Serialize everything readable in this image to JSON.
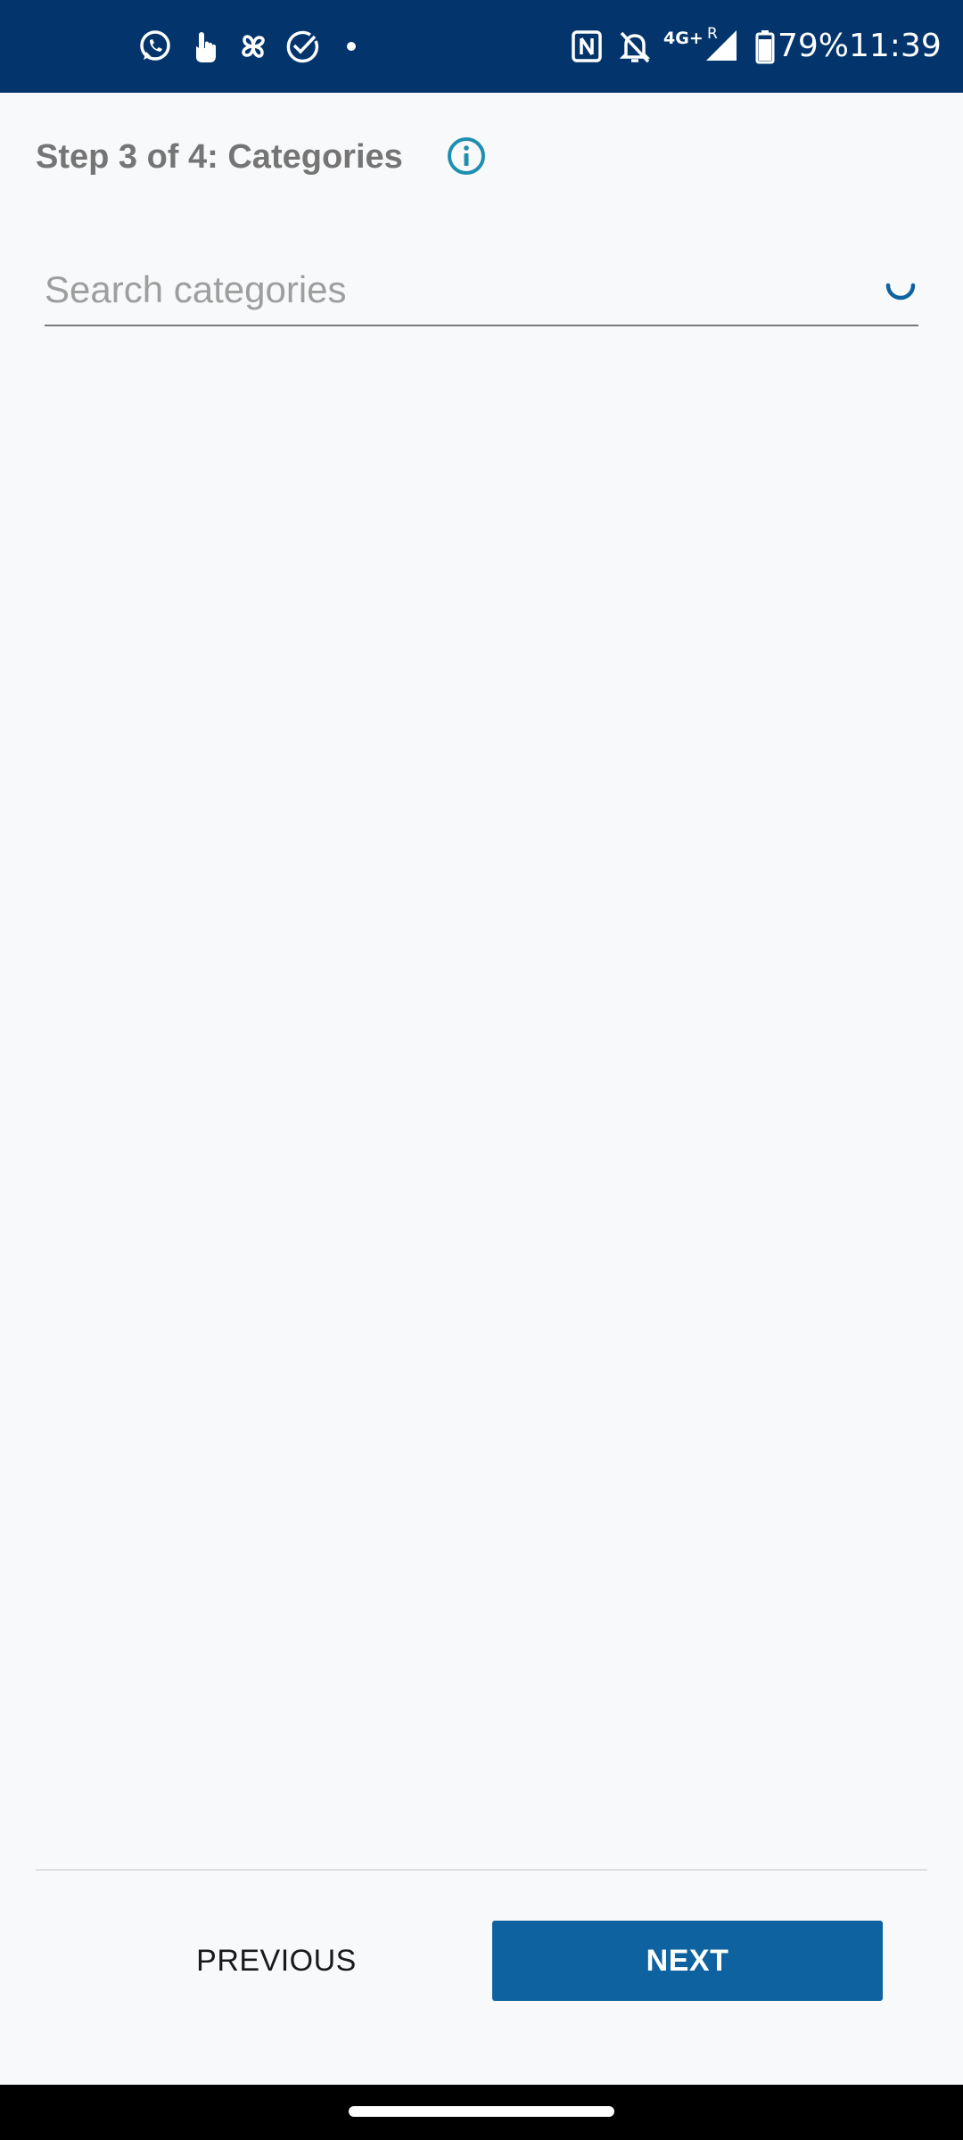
{
  "status_bar": {
    "network": "4G+",
    "roaming": "R",
    "battery": "79%",
    "time": "11:39",
    "icons": [
      "whatsapp-icon",
      "touch-icon",
      "pinwheel-icon",
      "check-circle-icon",
      "dot-icon",
      "nfc-icon",
      "bell-off-icon",
      "signal-icon",
      "battery-icon"
    ],
    "background": "#03356c"
  },
  "header": {
    "title": "Step 3 of 4: Categories",
    "info_icon": "info-icon",
    "info_color": "#1e8fb0"
  },
  "search": {
    "placeholder": "Search categories",
    "value": "",
    "loading_icon": "spinner-icon",
    "accent": "#0e62a0"
  },
  "footer": {
    "previous_label": "PREVIOUS",
    "next_label": "NEXT",
    "next_color": "#0e62a0"
  }
}
